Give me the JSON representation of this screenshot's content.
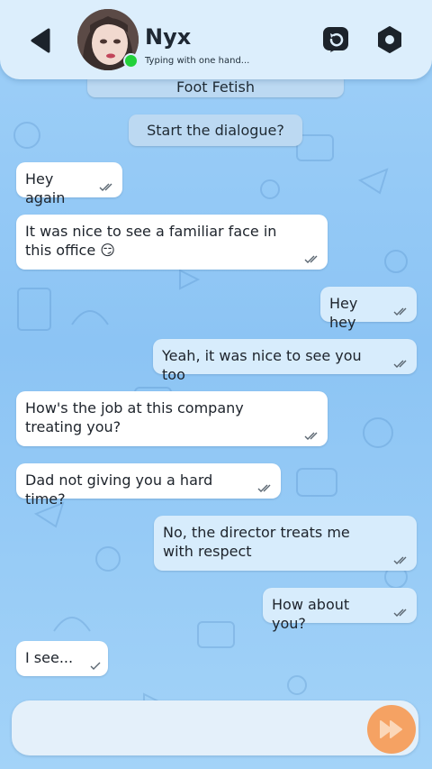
{
  "header": {
    "contact_name": "Nyx",
    "status_text": "Typing with one hand..."
  },
  "system": {
    "cut_pill_label": "Foot Fetish",
    "start_pill_label": "Start the dialogue?"
  },
  "messages": [
    {
      "text": "Hey again",
      "direction": "in"
    },
    {
      "text": "It was nice to see a familiar face in this office 😏",
      "direction": "in"
    },
    {
      "text": "Hey hey",
      "direction": "out"
    },
    {
      "text": "Yeah, it was nice to see you too",
      "direction": "out"
    },
    {
      "text": "How's the job at this company treating you?",
      "direction": "in"
    },
    {
      "text": "Dad not giving you a hard time?",
      "direction": "in"
    },
    {
      "text": "No, the director treats me with respect",
      "direction": "out"
    },
    {
      "text": "How about you?",
      "direction": "out"
    },
    {
      "text": "I see...",
      "direction": "in"
    }
  ],
  "colors": {
    "header_bg": "#dceefc",
    "incoming_bubble": "#ffffff",
    "outgoing_bubble": "#d7ecfc",
    "online_dot": "#22d13a",
    "send_button": "#f5a263"
  },
  "icons": [
    "back-arrow-icon",
    "rewind-icon",
    "settings-gear-icon",
    "read-check-icon",
    "send-forward-icon"
  ]
}
